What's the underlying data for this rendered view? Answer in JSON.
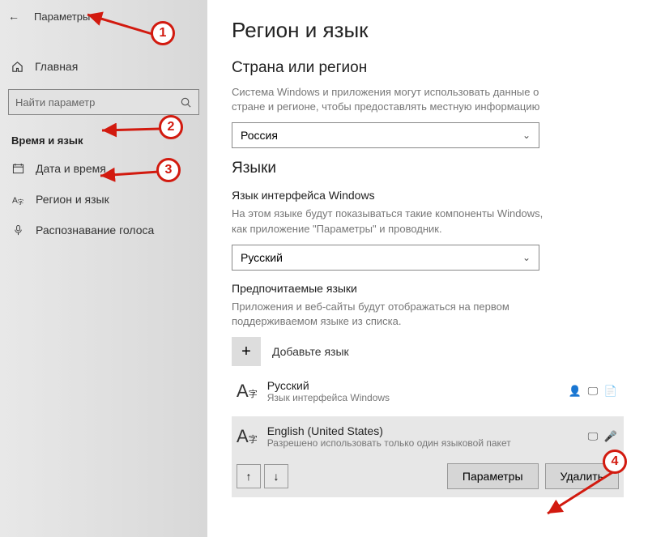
{
  "sidebar": {
    "header_title": "Параметры",
    "home_label": "Главная",
    "search_placeholder": "Найти параметр",
    "section_label": "Время и язык",
    "items": [
      {
        "label": "Дата и время"
      },
      {
        "label": "Регион и язык"
      },
      {
        "label": "Распознавание голоса"
      }
    ]
  },
  "main": {
    "page_title": "Регион и язык",
    "region_heading": "Страна или регион",
    "region_desc": "Система Windows и приложения могут использовать данные о стране и регионе, чтобы предоставлять местную информацию",
    "region_value": "Россия",
    "languages_heading": "Языки",
    "display_lang_label": "Язык интерфейса Windows",
    "display_lang_desc": "На этом языке будут показываться такие компоненты Windows, как приложение \"Параметры\" и проводник.",
    "display_lang_value": "Русский",
    "preferred_label": "Предпочитаемые языки",
    "preferred_desc": "Приложения и веб-сайты будут отображаться на первом поддерживаемом языке из списка.",
    "add_lang_label": "Добавьте язык",
    "langs": [
      {
        "name": "Русский",
        "sub": "Язык интерфейса Windows",
        "icons": "👤 🖵 📄"
      },
      {
        "name": "English (United States)",
        "sub": "Разрешено использовать только один языковой пакет",
        "icons": "🖵 🎤"
      }
    ],
    "btn_options": "Параметры",
    "btn_remove": "Удалить"
  },
  "callouts": {
    "c1": "1",
    "c2": "2",
    "c3": "3",
    "c4": "4"
  }
}
